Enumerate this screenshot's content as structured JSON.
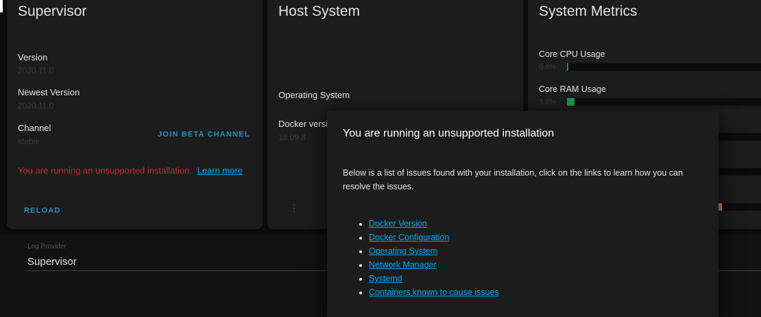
{
  "supervisor": {
    "title": "Supervisor",
    "version_label": "Version",
    "version_value": "2020.11.0",
    "newest_label": "Newest Version",
    "newest_value": "2020.11.0",
    "channel_label": "Channel",
    "channel_value": "stable",
    "join_beta_label": "JOIN BETA CHANNEL",
    "warning_text": "You are running an unsupported installation.",
    "learn_more": "Learn more",
    "reload_label": "RELOAD"
  },
  "host": {
    "title": "Host System",
    "os_label": "Operating System",
    "docker_label": "Docker versi",
    "docker_value": "18.09.8",
    "menu_icon": "more-vert-icon"
  },
  "metrics": {
    "title": "System Metrics",
    "cpu_label": "Core CPU Usage",
    "cpu_value": "0.6%",
    "cpu_fraction": 0.006,
    "ram_label": "Core RAM Usage",
    "ram_value": "3.6%",
    "ram_fraction": 0.036,
    "colors": {
      "cpu": "#0f9d58",
      "ram": "#0f9d58",
      "orange": "#e08a2b"
    }
  },
  "log": {
    "label": "Log Provider",
    "value": "Supervisor"
  },
  "dialog": {
    "title": "You are running an unsupported installation",
    "body": "Below is a list of issues found with your installation, click on the links to learn how you can resolve the issues.",
    "issues": [
      "Docker Version",
      "Docker Configuration",
      "Operating System",
      "Network Manager",
      "Systemd",
      "Containers known to cause issues"
    ]
  }
}
